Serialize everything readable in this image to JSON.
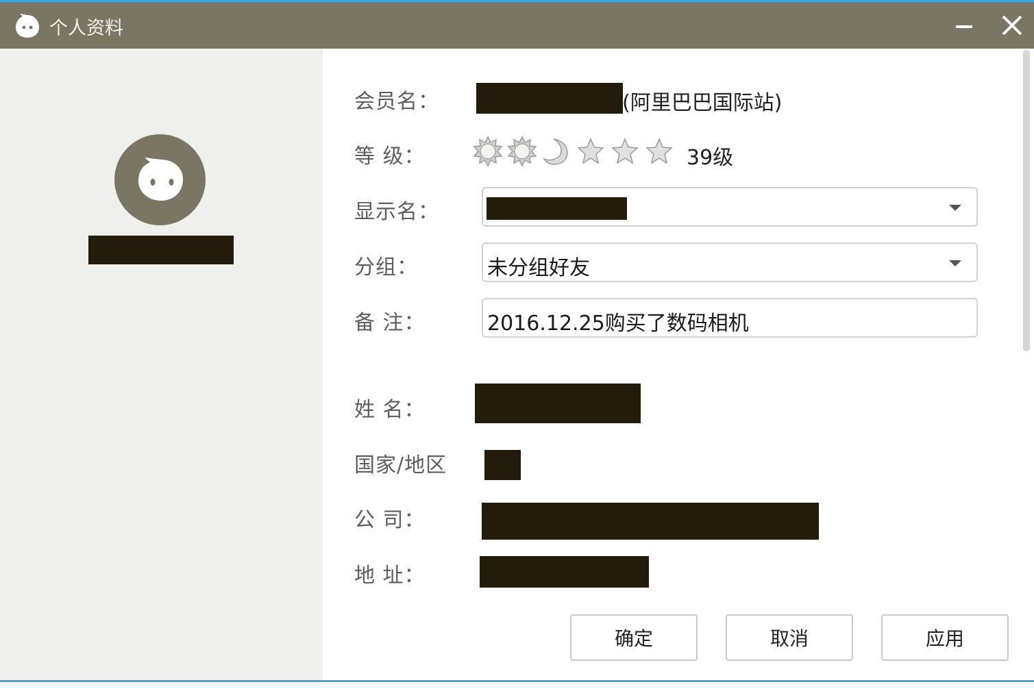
{
  "window": {
    "title": "个人资料",
    "app_icon": "ghost-logo-icon",
    "controls": [
      "minimize-icon",
      "close-icon"
    ]
  },
  "profile": {
    "avatar_icon": "ghost-avatar-icon"
  },
  "form": {
    "member_name_label": "会员名：",
    "member_name_suffix": "(阿里巴巴国际站)",
    "level_label": "等  级：",
    "level_icons": [
      "sun-icon",
      "sun-icon",
      "moon-icon",
      "star-icon",
      "star-icon",
      "star-icon"
    ],
    "level_text": "39级",
    "display_name_label": "显示名：",
    "group_label": "分组：",
    "group_value": "未分组好友",
    "note_label": "备  注：",
    "note_value": "2016.12.25购买了数码相机",
    "name_label": "姓  名：",
    "country_label": "国家/地区",
    "company_label": "公  司：",
    "address_label": "地  址："
  },
  "buttons": {
    "ok": "确定",
    "cancel": "取消",
    "apply": "应用"
  },
  "colors": {
    "titlebar": "#7a7663",
    "accent_line": "#3aa9d8",
    "redaction": "#231c0c",
    "left_panel": "#efefed"
  }
}
